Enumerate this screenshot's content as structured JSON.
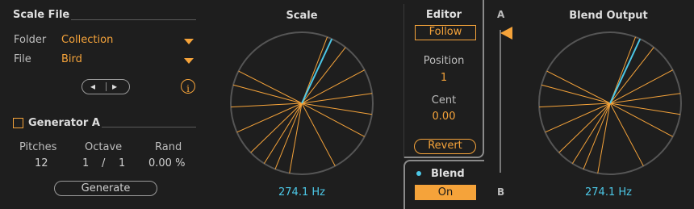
{
  "scale_file": {
    "title": "Scale File",
    "folder_label": "Folder",
    "folder_value": "Collection",
    "file_label": "File",
    "file_value": "Bird",
    "prev_glyph": "◂",
    "next_glyph": "▸",
    "info_glyph": "i"
  },
  "generator": {
    "title": "Generator A",
    "checked": false,
    "pitches_label": "Pitches",
    "octave_label": "Octave",
    "rand_label": "Rand",
    "pitches_value": "12",
    "octave_num": "1",
    "octave_sep": "/",
    "octave_den": "1",
    "rand_value": "0.00 %",
    "generate_label": "Generate"
  },
  "scale": {
    "title": "Scale",
    "freq": "274.1 Hz"
  },
  "editor": {
    "title": "Editor",
    "follow_label": "Follow",
    "position_label": "Position",
    "position_value": "1",
    "cent_label": "Cent",
    "cent_value": "0.00",
    "revert_label": "Revert"
  },
  "blend": {
    "label": "Blend",
    "state": "On",
    "a_label": "A",
    "b_label": "B",
    "level": 0.0
  },
  "blend_output": {
    "title": "Blend Output",
    "freq": "274.1 Hz"
  },
  "colors": {
    "accent": "#f5a33a",
    "highlight": "#4cc7e6",
    "ring": "#555555"
  },
  "dial_angles_deg": [
    21,
    38,
    62,
    82,
    99,
    118,
    152,
    190,
    202,
    212,
    226,
    246,
    267,
    285,
    297
  ],
  "dial_highlight_angle_deg": 25
}
